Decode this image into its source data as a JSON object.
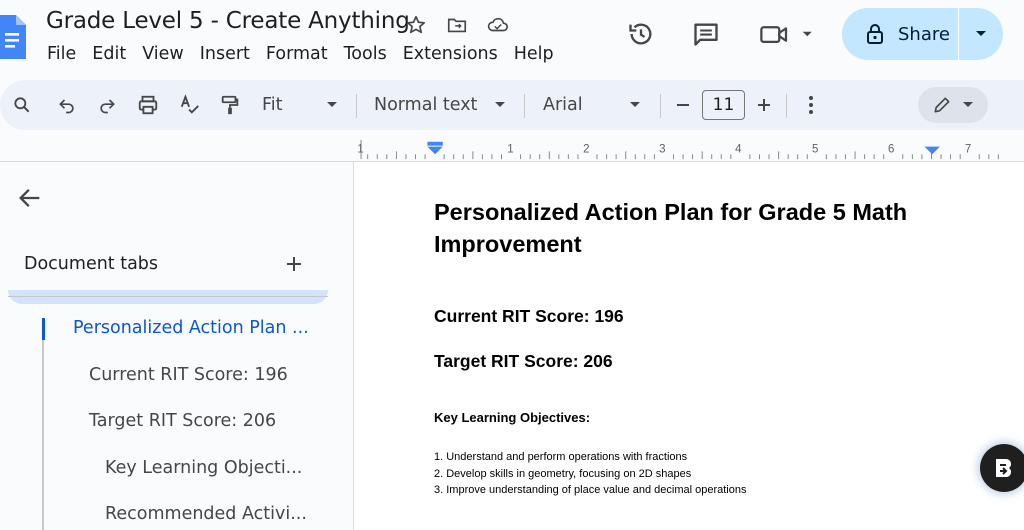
{
  "window": {
    "doc_title": "Grade Level 5 - Create Anything"
  },
  "menu": [
    "File",
    "Edit",
    "View",
    "Insert",
    "Format",
    "Tools",
    "Extensions",
    "Help"
  ],
  "share": {
    "label": "Share"
  },
  "toolbar": {
    "zoom": "Fit",
    "style": "Normal text",
    "font": "Arial",
    "font_size": "11"
  },
  "ruler": {
    "labels": [
      "1",
      "1",
      "2",
      "3",
      "4",
      "5",
      "6",
      "7"
    ]
  },
  "sidebar": {
    "heading": "Document tabs",
    "outline": [
      {
        "label": "Personalized Action Plan ...",
        "active": true
      },
      {
        "label": "Current RIT Score: 196",
        "active": false
      },
      {
        "label": "Target RIT Score: 206",
        "active": false
      },
      {
        "label": "Key Learning Objecti...",
        "active": false
      },
      {
        "label": "Recommended Activi...",
        "active": false
      }
    ]
  },
  "document": {
    "title": "Personalized Action Plan for Grade 5 Math Improvement",
    "current_score": "Current RIT Score: 196",
    "target_score": "Target RIT Score: 206",
    "objectives_heading": "Key Learning Objectives:",
    "objectives": [
      "1. Understand and perform operations with fractions",
      "2. Develop skills in geometry, focusing on 2D shapes",
      "3. Improve understanding of place value and decimal operations"
    ]
  },
  "icons": {
    "star": "star-icon",
    "move": "move-to-folder-icon",
    "cloud": "cloud-status-icon",
    "history": "version-history-icon",
    "comments": "comments-icon",
    "meet": "meet-video-icon",
    "lock": "lock-icon",
    "search": "search-icon",
    "undo": "undo-icon",
    "redo": "redo-icon",
    "print": "print-icon",
    "spellcheck": "spellcheck-icon",
    "paint_format": "paint-format-icon",
    "more": "more-vert-icon",
    "edit_mode": "edit-pencil-icon",
    "back": "back-arrow-icon",
    "add_tab": "add-tab-icon",
    "extension": "extension-fab-icon"
  },
  "colors": {
    "accent": "#0b57d0",
    "share_bg": "#c2e7ff",
    "toolbar_bg": "#edf2fa"
  }
}
